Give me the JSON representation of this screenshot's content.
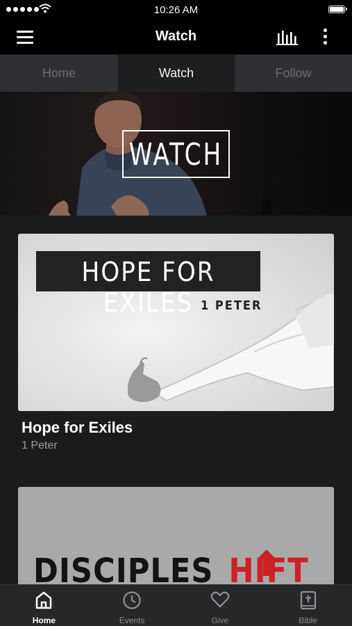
{
  "status_bar": {
    "time": "10:26 AM"
  },
  "nav": {
    "title": "Watch"
  },
  "tabs": [
    {
      "label": "Home",
      "active": false
    },
    {
      "label": "Watch",
      "active": true
    },
    {
      "label": "Follow",
      "active": false
    }
  ],
  "hero": {
    "label": "WATCH"
  },
  "cards": [
    {
      "artwork_title": "HOPE FOR EXILES",
      "artwork_subtitle": "1 PETER",
      "title": "Hope for Exiles",
      "subtitle": "1 Peter"
    },
    {
      "artwork_text_a": "DISCIPLES",
      "artwork_text_b": "HIFT"
    }
  ],
  "tab_bar": [
    {
      "label": "Home",
      "icon": "home-icon",
      "active": true
    },
    {
      "label": "Events",
      "icon": "clock-icon",
      "active": false
    },
    {
      "label": "Give",
      "icon": "heart-icon",
      "active": false
    },
    {
      "label": "Bible",
      "icon": "bible-icon",
      "active": false
    }
  ],
  "colors": {
    "background": "#1b1c1e",
    "nav_background": "#000000",
    "tab_inactive": "#2f3033",
    "accent_red": "#cc2127"
  }
}
